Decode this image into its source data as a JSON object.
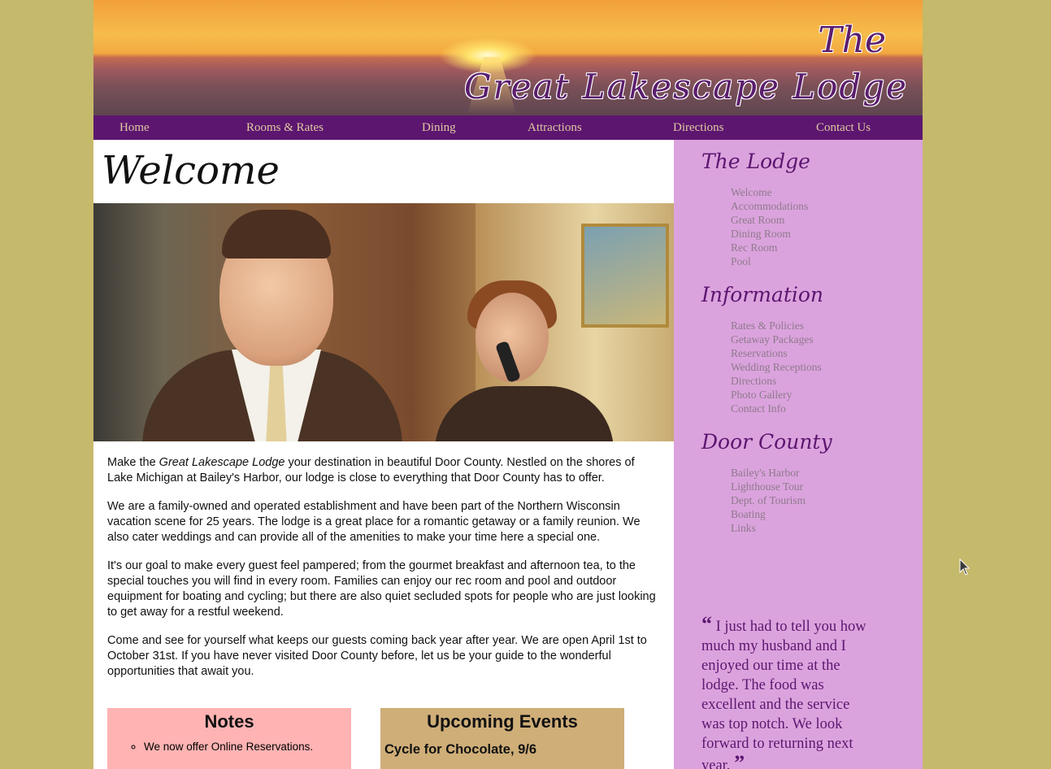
{
  "header": {
    "title_the": "The",
    "title_main": "Great Lakescape Lodge"
  },
  "nav": {
    "items": [
      "Home",
      "Rooms & Rates",
      "Dining",
      "Attractions",
      "Directions",
      "Contact Us"
    ]
  },
  "main": {
    "heading": "Welcome",
    "intro_before": "Make the ",
    "intro_em": "Great Lakescape Lodge",
    "intro_after": " your destination in beautiful Door County. Nestled on the shores of Lake Michigan at Bailey's Harbor, our lodge is close to everything that Door County has to offer.",
    "paragraphs": [
      "We are a family-owned and operated establishment and have been part of the Northern Wisconsin vacation scene for 25 years. The lodge is a great place for a romantic getaway or a family reunion. We also cater weddings and can provide all of the amenities to make your time here a special one.",
      "It's our goal to make every guest feel pampered; from the gourmet breakfast and afternoon tea, to the special touches you will find in every room. Families can enjoy our rec room and pool and outdoor equipment for boating and cycling; but there are also quiet secluded spots for people who are just looking to get away for a restful weekend.",
      "Come and see for yourself what keeps our guests coming back year after year. We are open April 1st to October 31st. If you have never visited Door County before, let us be your guide to the wonderful opportunities that await you."
    ],
    "notes": {
      "title": "Notes",
      "items": [
        "We now offer Online Reservations."
      ]
    },
    "events": {
      "title": "Upcoming Events",
      "items": [
        "Cycle for Chocolate, 9/6"
      ]
    }
  },
  "sidebar": {
    "lodge": {
      "heading": "The Lodge",
      "links": [
        "Welcome",
        "Accommodations",
        "Great Room",
        "Dining Room",
        "Rec Room",
        "Pool"
      ]
    },
    "information": {
      "heading": "Information",
      "links": [
        "Rates & Policies",
        "Getaway Packages",
        "Reservations",
        "Wedding Receptions",
        "Directions",
        "Photo Gallery",
        "Contact Info"
      ]
    },
    "door_county": {
      "heading": "Door County",
      "links": [
        "Bailey's Harbor",
        "Lighthouse Tour",
        "Dept. of Tourism",
        "Boating",
        "Links"
      ]
    },
    "testimonial": {
      "open_quote": "“",
      "text": " I just had to tell you how much my husband and I enjoyed our time at the lodge. The food was excellent and the service was top notch. We look forward to returning next year. ",
      "close_quote": "”"
    }
  },
  "colors": {
    "page_background": "#c5b96b",
    "nav_background": "#5c1670",
    "nav_text": "#e0c9a0",
    "sidebar_background": "#dba3dd",
    "heading_purple": "#5c1670",
    "notes_background": "#ffb3b3",
    "events_background": "#cfae78"
  }
}
